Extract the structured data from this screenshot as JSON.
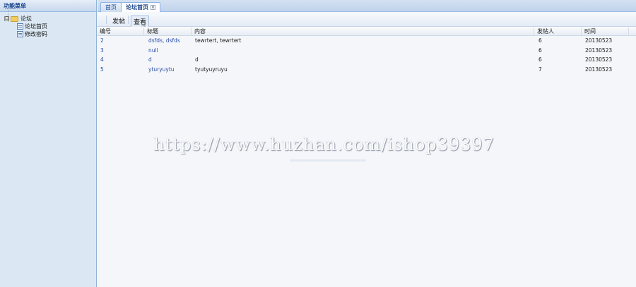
{
  "sidebar": {
    "title": "功能菜单",
    "root": {
      "label": "论坛",
      "toggle": "⊟"
    },
    "items": [
      {
        "label": "论坛首页"
      },
      {
        "label": "修改密码"
      }
    ]
  },
  "tabs": [
    {
      "label": "首页"
    },
    {
      "label": "论坛首页",
      "close": "×"
    }
  ],
  "toolbar": {
    "post_label": "发帖",
    "view_label": "查看"
  },
  "grid": {
    "columns": [
      "编号",
      "标题",
      "内容",
      "发帖人",
      "时间"
    ],
    "rows": [
      {
        "id": "2",
        "title": "dsfds, dsfds",
        "content": "tewrtert, tewrtert",
        "author": "6",
        "date": "20130523"
      },
      {
        "id": "3",
        "title": "null",
        "content": "",
        "author": "6",
        "date": "20130523"
      },
      {
        "id": "4",
        "title": "d",
        "content": "d",
        "author": "6",
        "date": "20130523"
      },
      {
        "id": "5",
        "title": "yturyuytu",
        "content": "tyutyuyruyu",
        "author": "7",
        "date": "20130523"
      }
    ]
  },
  "watermark": "https://www.huzhan.com/ishop39397",
  "colors": {
    "link": "#2a4da8",
    "header_text": "#15428b"
  }
}
